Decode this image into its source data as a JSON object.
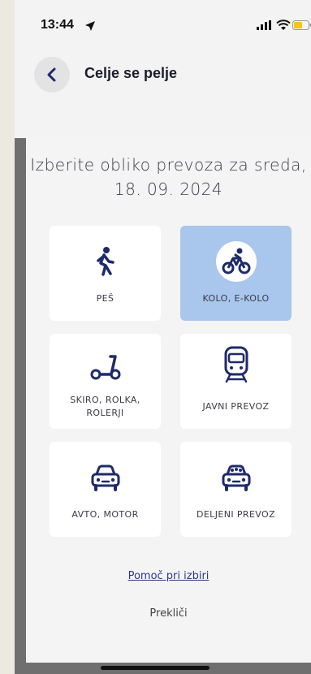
{
  "status_bar": {
    "time": "13:44"
  },
  "header": {
    "title": "Celje se pelje"
  },
  "prompt": {
    "line1": "Izberite obliko prevoza za sreda,",
    "line2": "18. 09. 2024"
  },
  "options": [
    {
      "label": "PEŠ",
      "icon": "walking-icon",
      "selected": false
    },
    {
      "label": "KOLO, E-KOLO",
      "icon": "bicycle-icon",
      "selected": true
    },
    {
      "label_line1": "SKIRO, ROLKA,",
      "label_line2": "ROLERJI",
      "icon": "scooter-icon",
      "selected": false
    },
    {
      "label": "JAVNI PREVOZ",
      "icon": "train-icon",
      "selected": false
    },
    {
      "label": "AVTO, MOTOR",
      "icon": "car-icon",
      "selected": false
    },
    {
      "label": "DELJENI PREVOZ",
      "icon": "shared-car-icon",
      "selected": false
    }
  ],
  "help_link": "Pomoč pri izbiri",
  "cancel": "Prekliči",
  "colors": {
    "selected_card": "#a9c6ec",
    "icon": "#1f2a6b",
    "link": "#2c3a8c"
  }
}
